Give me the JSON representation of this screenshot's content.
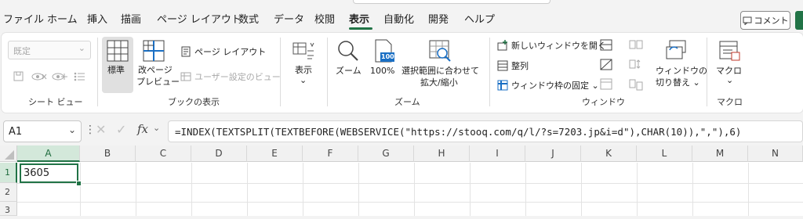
{
  "menu": {
    "tabs": [
      {
        "label": "ファイル"
      },
      {
        "label": "ホーム"
      },
      {
        "label": "挿入"
      },
      {
        "label": "描画"
      },
      {
        "label": "ページ レイアウト"
      },
      {
        "label": "数式"
      },
      {
        "label": "データ"
      },
      {
        "label": "校閲"
      },
      {
        "label": "表示",
        "active": true
      },
      {
        "label": "自動化"
      },
      {
        "label": "開発"
      },
      {
        "label": "ヘルプ"
      }
    ],
    "comment_label": "コメント",
    "accent": "#217346"
  },
  "ribbon": {
    "sheet_view": {
      "dropdown_value": "既定",
      "group_label": "シート ビュー"
    },
    "book_view": {
      "normal": "標準",
      "page_break_line1": "改ページ",
      "page_break_line2": "プレビュー",
      "page_layout": "ページ レイアウト",
      "custom_view": "ユーザー設定のビュー",
      "group_label": "ブックの表示"
    },
    "show": {
      "label": "表示",
      "chevron": "⌄"
    },
    "zoom": {
      "zoom_label": "ズーム",
      "hundred_label": "100%",
      "hundred_icon_text": "100",
      "fit_line1": "選択範囲に合わせて",
      "fit_line2": "拡大/縮小",
      "group_label": "ズーム"
    },
    "window": {
      "new_window": "新しいウィンドウを開く",
      "arrange": "整列",
      "freeze": "ウィンドウ枠の固定 ⌄",
      "switch_line1": "ウィンドウの",
      "switch_line2": "切り替え ⌄",
      "group_label": "ウィンドウ"
    },
    "macro": {
      "label": "マクロ",
      "chevron": "⌄",
      "group_label": "マクロ"
    }
  },
  "formula_bar": {
    "name_box": "A1",
    "fx": "fx",
    "formula": "=INDEX(TEXTSPLIT(TEXTBEFORE(WEBSERVICE(\"https://stooq.com/q/l/?s=7203.jp&i=d\"),CHAR(10)),\",\"),6)"
  },
  "grid": {
    "columns": [
      "A",
      "B",
      "C",
      "D",
      "E",
      "F",
      "G",
      "H",
      "I",
      "J",
      "K",
      "L",
      "M",
      "N"
    ],
    "rows": [
      "1",
      "2",
      "3"
    ],
    "cell_a1": "3605"
  }
}
